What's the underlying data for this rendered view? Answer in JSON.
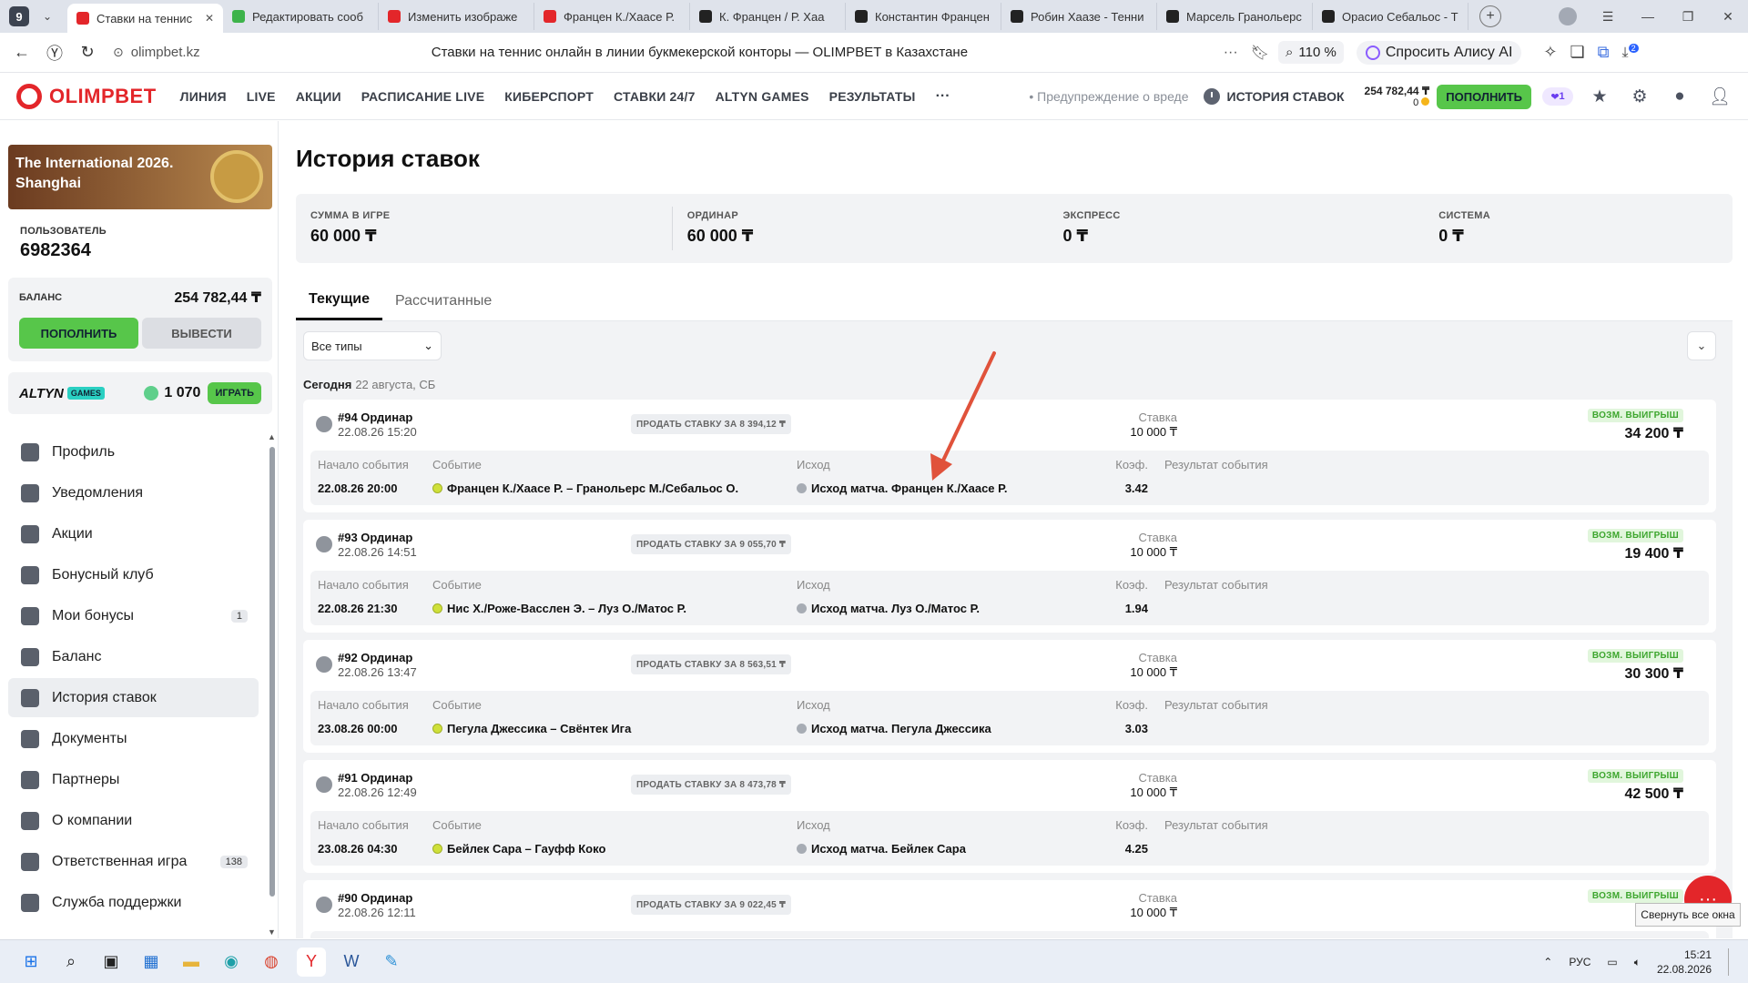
{
  "browser": {
    "tab_count": "9",
    "tabs": [
      {
        "title": "Ставки на теннис",
        "icon": "olimpbet-icon",
        "color": "#e3262a",
        "active": true
      },
      {
        "title": "Редактировать сооб",
        "icon": "leaf-icon",
        "color": "#3db34a"
      },
      {
        "title": "Изменить изображе",
        "icon": "image-icon",
        "color": "#e3262a"
      },
      {
        "title": "Францен К./Хаасе Р.",
        "icon": "yandex-icon",
        "color": "#e3262a"
      },
      {
        "title": "К. Францен / Р. Хаа",
        "icon": "flashscore-icon",
        "color": "#222"
      },
      {
        "title": "Константин Францен",
        "icon": "flashscore-icon",
        "color": "#222"
      },
      {
        "title": "Робин Хаазе - Тенни",
        "icon": "flashscore-icon",
        "color": "#222"
      },
      {
        "title": "Марсель Гранольерс",
        "icon": "flashscore-icon",
        "color": "#222"
      },
      {
        "title": "Орасио Себальос - Т",
        "icon": "flashscore-icon",
        "color": "#222"
      }
    ],
    "url_host": "olimpbet.kz",
    "page_title": "Ставки на теннис онлайн в линии букмекерской конторы — OLIMPBET в Казахстане",
    "zoom": "110 %",
    "alice": "Спросить Алису AI",
    "ext_badge": "2"
  },
  "header": {
    "logo": "OLIMPBET",
    "nav": [
      "ЛИНИЯ",
      "LIVE",
      "АКЦИИ",
      "РАСПИСАНИЕ LIVE",
      "КИБЕРСПОРТ",
      "СТАВКИ 24/7",
      "ALTYN GAMES",
      "РЕЗУЛЬТАТЫ"
    ],
    "more": "···",
    "warning": "Предупреждение о вреде",
    "history": "ИСТОРИЯ СТАВОК",
    "balance": "254 782,44 ₸",
    "bonus": "0",
    "topup": "ПОПОЛНИТЬ",
    "gift_count": "1"
  },
  "sidebar": {
    "banner": "The International 2026. Shanghai",
    "user_label": "ПОЛЬЗОВАТЕЛЬ",
    "user_id": "6982364",
    "balance_label": "БАЛАНС",
    "balance_value": "254 782,44 ₸",
    "topup": "ПОПОЛНИТЬ",
    "withdraw": "ВЫВЕСТИ",
    "altyn_label": "ALTYN",
    "altyn_games": "GAMES",
    "altyn_coins": "1 070",
    "altyn_play": "ИГРАТЬ",
    "items": [
      {
        "label": "Профиль",
        "icon": "user-icon"
      },
      {
        "label": "Уведомления",
        "icon": "bell-icon"
      },
      {
        "label": "Акции",
        "icon": "gift-icon"
      },
      {
        "label": "Бонусный клуб",
        "icon": "club-icon"
      },
      {
        "label": "Мои бонусы",
        "icon": "star-icon",
        "badge": "1"
      },
      {
        "label": "Баланс",
        "icon": "wallet-icon"
      },
      {
        "label": "История ставок",
        "icon": "clock-icon",
        "active": true
      },
      {
        "label": "Документы",
        "icon": "document-icon"
      },
      {
        "label": "Партнеры",
        "icon": "handshake-icon"
      },
      {
        "label": "О компании",
        "icon": "info-icon"
      },
      {
        "label": "Ответственная игра",
        "icon": "lock-icon",
        "badge": "138"
      },
      {
        "label": "Служба поддержки",
        "icon": "support-icon"
      }
    ]
  },
  "main": {
    "title": "История ставок",
    "summary": [
      {
        "label": "СУММА В ИГРЕ",
        "value": "60 000 ₸"
      },
      {
        "label": "ОРДИНАР",
        "value": "60 000 ₸"
      },
      {
        "label": "ЭКСПРЕСС",
        "value": "0 ₸"
      },
      {
        "label": "СИСТЕМА",
        "value": "0 ₸"
      }
    ],
    "tabs": [
      "Текущие",
      "Рассчитанные"
    ],
    "filter": "Все типы",
    "date_header": "Сегодня",
    "date_value": "22 августа, СБ",
    "col_headers": {
      "start": "Начало события",
      "event": "Событие",
      "outcome": "Исход",
      "coef": "Коэф.",
      "result": "Результат события",
      "stake": "Ставка",
      "win": "ВОЗМ. ВЫИГРЫШ"
    },
    "bets": [
      {
        "number": "#94 Ординар",
        "date": "22.08.26 15:20",
        "sell": "ПРОДАТЬ СТАВКУ ЗА 8 394,12 ₸",
        "stake": "10 000 ₸",
        "win": "34 200 ₸",
        "start": "22.08.26 20:00",
        "event": "Францен К./Хаасе Р. – Гранольерс М./Себальос О.",
        "outcome": "Исход матча. Францен К./Хаасе Р.",
        "coef": "3.42"
      },
      {
        "number": "#93 Ординар",
        "date": "22.08.26 14:51",
        "sell": "ПРОДАТЬ СТАВКУ ЗА 9 055,70 ₸",
        "stake": "10 000 ₸",
        "win": "19 400 ₸",
        "start": "22.08.26 21:30",
        "event": "Нис Х./Роже-Васслен Э. – Луз О./Матос Р.",
        "outcome": "Исход матча. Луз О./Матос Р.",
        "coef": "1.94"
      },
      {
        "number": "#92 Ординар",
        "date": "22.08.26 13:47",
        "sell": "ПРОДАТЬ СТАВКУ ЗА 8 563,51 ₸",
        "stake": "10 000 ₸",
        "win": "30 300 ₸",
        "start": "23.08.26 00:00",
        "event": "Пегула Джессика – Свёнтек Ига",
        "outcome": "Исход матча. Пегула Джессика",
        "coef": "3.03"
      },
      {
        "number": "#91 Ординар",
        "date": "22.08.26 12:49",
        "sell": "ПРОДАТЬ СТАВКУ ЗА 8 473,78 ₸",
        "stake": "10 000 ₸",
        "win": "42 500 ₸",
        "start": "23.08.26 04:30",
        "event": "Бейлек Сара – Гауфф Коко",
        "outcome": "Исход матча. Бейлек Сара",
        "coef": "4.25"
      },
      {
        "number": "#90 Ординар",
        "date": "22.08.26 12:11",
        "sell": "ПРОДАТЬ СТАВКУ ЗА 9 022,45 ₸",
        "stake": "10 000 ₸",
        "win": "",
        "start": "",
        "event": "",
        "outcome": "",
        "coef": ""
      }
    ]
  },
  "overlay": {
    "tooltip": "Свернуть все окна"
  },
  "taskbar": {
    "lang": "РУС",
    "time": "15:21",
    "date": "22.08.2026"
  }
}
